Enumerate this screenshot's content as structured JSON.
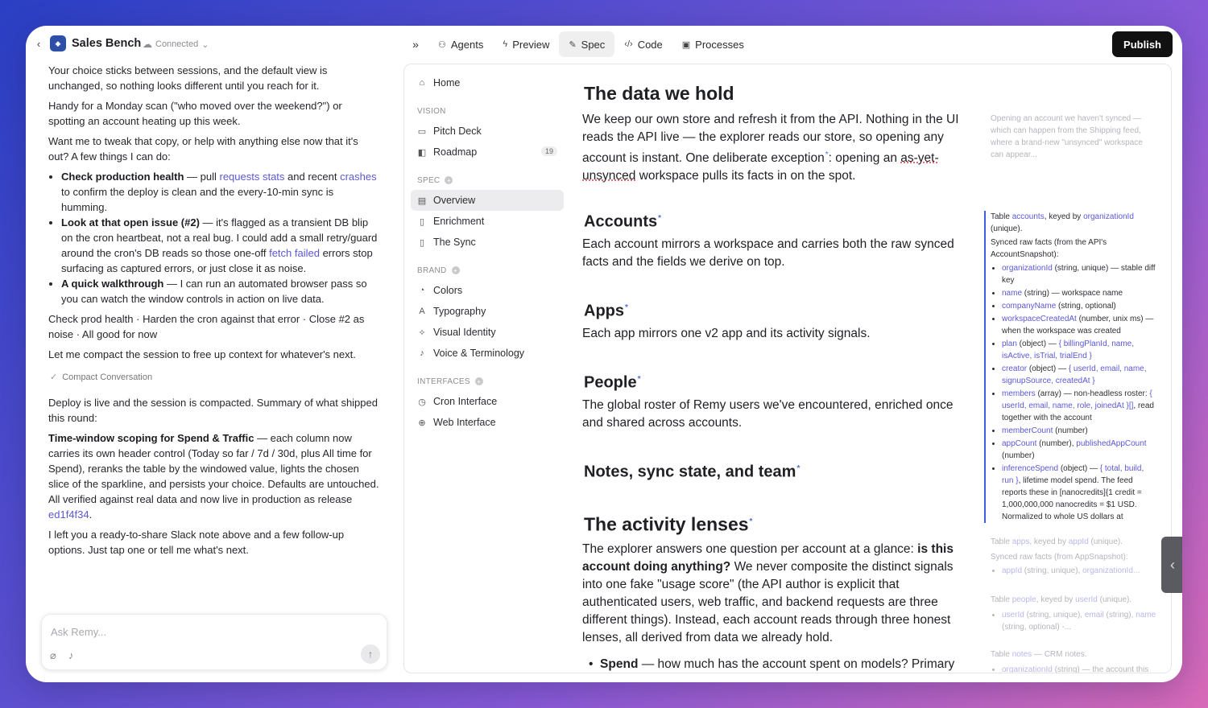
{
  "header": {
    "app_title": "Sales Bench",
    "status": "Connected",
    "tabs": [
      {
        "label": "Agents",
        "icon": "agents-icon"
      },
      {
        "label": "Preview",
        "icon": "bolt-icon"
      },
      {
        "label": "Spec",
        "icon": "edit-icon"
      },
      {
        "label": "Code",
        "icon": "code-icon"
      },
      {
        "label": "Processes",
        "icon": "cpu-icon"
      }
    ],
    "publish_label": "Publish"
  },
  "chat": {
    "p1": "Your choice sticks between sessions, and the default view is unchanged, so nothing looks different until you reach for it.",
    "p2": "Handy for a Monday scan (\"who moved over the weekend?\") or spotting an account heating up this week.",
    "p3": "Want me to tweak that copy, or help with anything else now that it's out? A few things I can do:",
    "b1_strong": "Check production health",
    "b1_a": " — pull ",
    "b1_link1": "requests stats",
    "b1_b": " and recent ",
    "b1_link2": "crashes",
    "b1_c": " to confirm the deploy is clean and the every-10-min sync is humming.",
    "b2_strong": "Look at that open issue (#2)",
    "b2_a": " — it's flagged as a transient DB blip on the cron heartbeat, not a real bug. I could add a small retry/guard around the cron's DB reads so those one-off ",
    "b2_link": "fetch failed",
    "b2_b": " errors stop surfacing as captured errors, or just close it as noise.",
    "b3_strong": "A quick walkthrough",
    "b3_a": " — I can run an automated browser pass so you can watch the window controls in action on live data.",
    "p4": "Check prod health · Harden the cron against that error · Close #2 as noise · All good for now",
    "p5": "Let me compact the session to free up context for whatever's next.",
    "compact_label": "Compact Conversation",
    "p6": "Deploy is live and the session is compacted. Summary of what shipped this round:",
    "p7_strong": "Time-window scoping for Spend & Traffic",
    "p7_a": " — each column now carries its own header control (Today so far / 7d / 30d, plus All time for Spend), reranks the table by the windowed value, lights the chosen slice of the sparkline, and persists your choice. Defaults are untouched. All verified against real data and now live in production as release ",
    "p7_link": "ed1f4f34",
    "p7_b": ".",
    "p8": "I left you a ready-to-share Slack note above and a few follow-up options. Just tap one or tell me what's next.",
    "input_placeholder": "Ask Remy..."
  },
  "nav": {
    "home": "Home",
    "vision_label": "VISION",
    "pitch_deck": "Pitch Deck",
    "roadmap": "Roadmap",
    "roadmap_count": "19",
    "spec_label": "SPEC",
    "overview": "Overview",
    "enrichment": "Enrichment",
    "the_sync": "The Sync",
    "brand_label": "BRAND",
    "colors": "Colors",
    "typography": "Typography",
    "visual_identity": "Visual Identity",
    "voice": "Voice & Terminology",
    "interfaces_label": "INTERFACES",
    "cron_interface": "Cron Interface",
    "web_interface": "Web Interface"
  },
  "doc": {
    "h_data": "The data we hold",
    "p_data_a": "We keep our own store and refresh it from the API. Nothing in the UI reads the API live — the explorer reads our store, so opening any account is instant. One deliberate exception",
    "p_data_b": ": opening an ",
    "p_data_sq": "as-yet-unsynced",
    "p_data_c": " workspace pulls its facts in on the spot.",
    "h_accounts": "Accounts",
    "p_accounts": "Each account mirrors a workspace and carries both the raw synced facts and the fields we derive on top.",
    "h_apps": "Apps",
    "p_apps": "Each app mirrors one v2 app and its activity signals.",
    "h_people": "People",
    "p_people": "The global roster of Remy users we've encountered, enriched once and shared across accounts.",
    "h_notes": "Notes, sync state, and team",
    "h_lenses": "The activity lenses",
    "p_lenses_a": "The explorer answers one question per account at a glance: ",
    "p_lenses_strong": "is this account doing anything?",
    "p_lenses_b": " We never composite the distinct signals into one fake \"usage score\" (the API author is explicit that authenticated users, web traffic, and backend requests are three different things). Instead, each account reads through three honest lenses, all derived from data we already hold.",
    "spend_strong": "Spend",
    "spend_text": " — how much has the account spent on models? Primary",
    "marker": "*"
  },
  "side": {
    "note1": "Opening an account we haven't synced — which can happen from the Shipping feed, where a brand-new \"unsynced\" workspace can appear...",
    "acc_a": "Table ",
    "acc_link": "accounts",
    "acc_b": ", keyed by ",
    "acc_key": "organizationId",
    "acc_c": " (unique).",
    "acc_sub": "Synced raw facts (from the API's AccountSnapshot):",
    "f1_link": "organizationId",
    "f1_text": " (string, unique) — stable diff key",
    "f2_link": "name",
    "f2_text": " (string) — workspace name",
    "f3_link": "companyName",
    "f3_text": " (string, optional)",
    "f4_link": "workspaceCreatedAt",
    "f4_text": " (number, unix ms) — when the workspace was created",
    "f5_link": "plan",
    "f5_text": " (object) — ",
    "f5_link2": "{ billingPlanId, name, isActive, isTrial, trialEnd }",
    "f6_link": "creator",
    "f6_text": " (object) — ",
    "f6_link2": "{ userId, email, name, signupSource, createdAt }",
    "f7_link": "members",
    "f7_text": " (array) — non-headless roster: ",
    "f7_link2": "{ userId, email, name, role, joinedAt }[]",
    "f7_text2": ", read together with the account",
    "f8_link": "memberCount",
    "f8_text": " (number)",
    "f9_link": "appCount",
    "f9_text": " (number), ",
    "f9_link2": "publishedAppCount",
    "f9_text2": " (number)",
    "f10_link": "inferenceSpend",
    "f10_text": " (object) — ",
    "f10_link2": "{ total, build, run }",
    "f10_text2": ", lifetime model spend. The feed reports these in [nanocredits]{1 credit = 1,000,000,000 nanocredits = $1 USD. Normalized to whole US dollars at",
    "apps_a": "Table ",
    "apps_link": "apps",
    "apps_b": ", keyed by ",
    "apps_key": "appId",
    "apps_c": " (unique).",
    "apps_sub": "Synced raw facts (from AppSnapshot):",
    "apps_f1_link": "appId",
    "apps_f1_text": " (string, unique), ",
    "apps_f1_link2": "organizationId...",
    "people_a": "Table ",
    "people_link": "people",
    "people_b": ", keyed by ",
    "people_key": "userId",
    "people_c": " (unique).",
    "people_f1_link": "userId",
    "people_f1_text": " (string, unique), ",
    "people_f1_link2": "email",
    "people_f1_text2": " (string), ",
    "people_f1_link3": "name",
    "people_f1_text3": " (string, optional) -...",
    "notes_a": "Table ",
    "notes_link": "notes",
    "notes_b": " — CRM notes.",
    "notes_f1_link": "organizationId",
    "notes_f1_text": " (string) — the account this"
  },
  "colors": {
    "accent": "#3b5fe0",
    "link": "#5b58d6",
    "publish_bg": "#111111"
  }
}
